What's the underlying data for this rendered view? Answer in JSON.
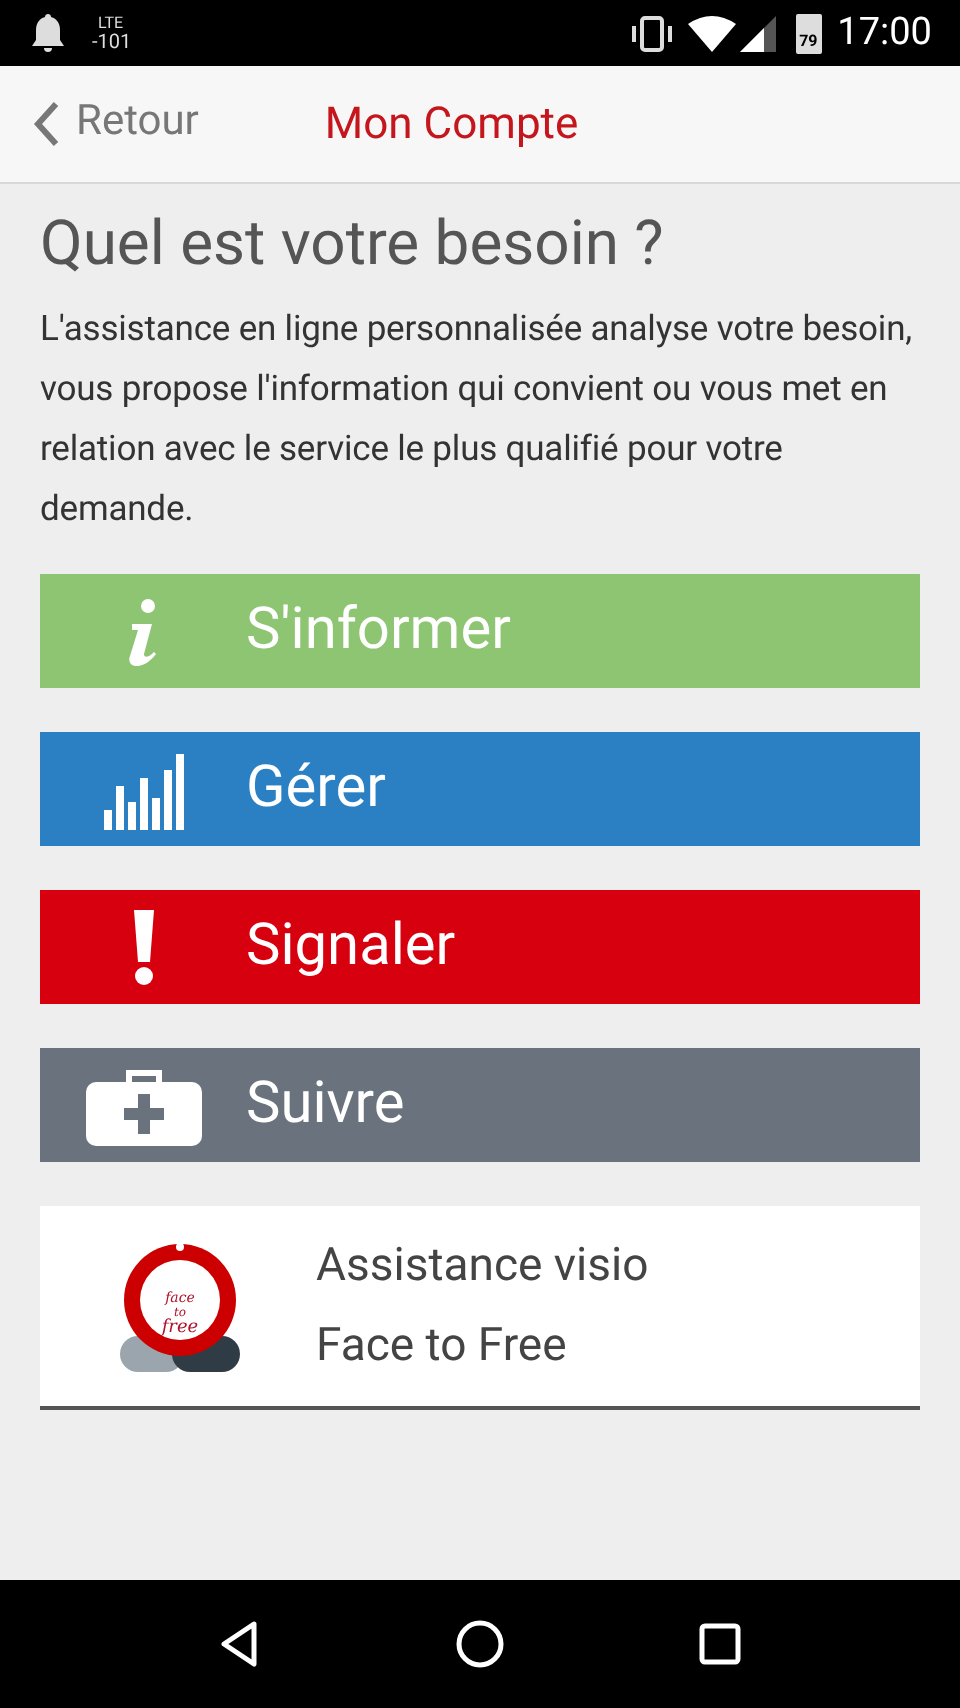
{
  "status_bar": {
    "network": "LTE",
    "signal_value": "-101",
    "battery": "79",
    "time": "17:00"
  },
  "header": {
    "back_label": "Retour",
    "title": "Mon Compte"
  },
  "heading": "Quel est votre besoin ?",
  "intro": "L'assistance en ligne personnalisée analyse votre besoin, vous propose l'information qui convient ou vous met en relation avec le service le plus qualifié pour votre demande.",
  "actions": [
    {
      "kind": "info",
      "label": "S'informer",
      "color": "#8dc572"
    },
    {
      "kind": "chart",
      "label": "Gérer",
      "color": "#2a80c3"
    },
    {
      "kind": "alert",
      "label": "Signaler",
      "color": "#d7000f"
    },
    {
      "kind": "kit",
      "label": "Suivre",
      "color": "#6a737d"
    }
  ],
  "visio_card": {
    "logo_lines": [
      "face",
      "to",
      "free"
    ],
    "line_1": "Assistance visio",
    "line_2": "Face to Free"
  }
}
